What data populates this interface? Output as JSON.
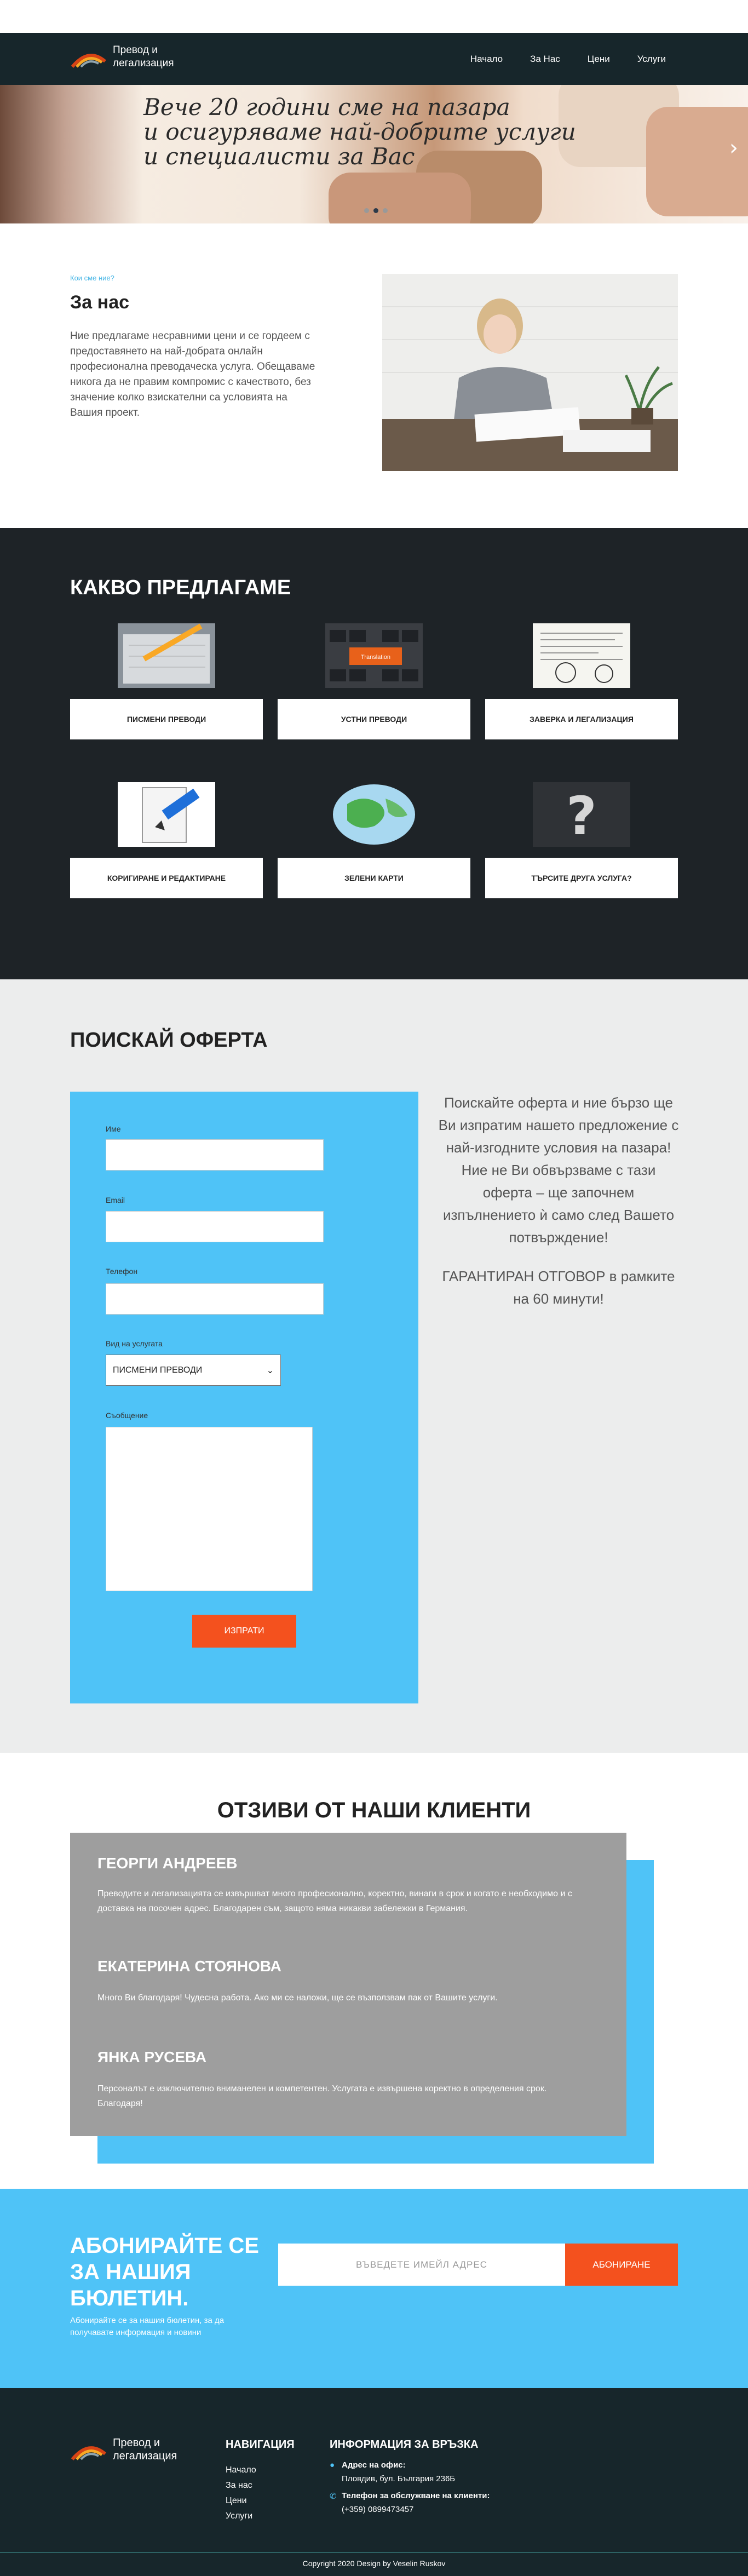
{
  "brand": {
    "name_line1": "Превод и",
    "name_line2": "легализация"
  },
  "nav": {
    "items": [
      "Начало",
      "За Нас",
      "Цени",
      "Услуги"
    ]
  },
  "hero": {
    "lines": [
      "Вече 20 години сме на пазара",
      "и осигуряваме най-добрите услуги",
      "и специалисти за Вас"
    ],
    "next_icon": "chevron-right-icon",
    "slides": 3,
    "active_slide": 1
  },
  "about": {
    "kicker": "Кои сме ние?",
    "title": "За нас",
    "text": "Ние предлагаме несравними цени и се гордеем с предоставянето на най-добрата онлайн професионална преводаческа услуга. Обещаваме никога да не правим компромис с качеството, без значение колко взискателни са условията на Вашия проект."
  },
  "services": {
    "title": "КАКВО ПРЕДЛАГАМЕ",
    "items": [
      {
        "label": "ПИСМЕНИ ПРЕВОДИ",
        "icon": "pen-on-book-icon"
      },
      {
        "label": "УСТНИ ПРЕВОДИ",
        "icon": "keyboard-translate-key-icon"
      },
      {
        "label": "ЗАВЕРКА И ЛЕГАЛИЗАЦИЯ",
        "icon": "stamped-document-icon"
      },
      {
        "label": "КОРИГИРАНЕ И РЕДАКТИРАНЕ",
        "icon": "document-pencil-icon"
      },
      {
        "label": "ЗЕЛЕНИ КАРТИ",
        "icon": "globe-icon"
      },
      {
        "label": "ТЪРСИТЕ ДРУГА УСЛУГА?",
        "icon": "question-mark-icon"
      }
    ]
  },
  "offer": {
    "title": "ПОИСКАЙ ОФЕРТА",
    "form": {
      "name_label": "Име",
      "email_label": "Email",
      "phone_label": "Телефон",
      "service_label": "Вид на услугата",
      "service_value": "ПИСМЕНИ ПРЕВОДИ",
      "message_label": "Съобщение",
      "submit": "ИЗПРАТИ"
    },
    "text1": "Поискайте оферта и ние бързо ще Ви изпратим нашето предложение с най-изгодните условия на пазара! Ние не Ви обвързваме с тази оферта – ще започнем изпълнението ѝ само след Вашето потвърждение!",
    "text2": "ГАРАНТИРАН ОТГОВОР в рамките на 60 минути!"
  },
  "testimonials": {
    "title": "ОТЗИВИ ОТ НАШИ КЛИЕНТИ",
    "items": [
      {
        "name": "ГЕОРГИ АНДРЕЕВ",
        "text": "Преводите и легализацията се извършват много професионално, коректно, винаги в срок и когато е необходимо и с доставка на посочен адрес. Благодарен съм, защото няма никакви забележки в Германия."
      },
      {
        "name": "ЕКАТЕРИНА СТОЯНОВА",
        "text": "Много Ви благодаря! Чудесна работа. Ако ми се наложи, ще се възползвам пак от Вашите услуги."
      },
      {
        "name": "ЯНКА РУСЕВА",
        "text": "Персоналът е изключително вниманелен и компетентен. Услугата е извършена коректно в определения срок. Благодаря!"
      }
    ]
  },
  "newsletter": {
    "title": "АБОНИРАЙТЕ СЕ ЗА НАШИЯ БЮЛЕТИН.",
    "subtitle": "Абонирайте се за нашия бюлетин, за да получавате информация и новини",
    "placeholder": "ВЪВЕДЕТЕ ИМЕЙЛ АДРЕС",
    "button": "АБОНИРАНЕ"
  },
  "footer": {
    "nav_title": "НАВИГАЦИЯ",
    "nav_items": [
      "Начало",
      "За нас",
      "Цени",
      "Услуги"
    ],
    "contact_title": "ИНФОРМАЦИЯ ЗА ВРЪЗКА",
    "address_label": "Адрес на офис:",
    "address_value": "Пловдив, бул. България 236Б",
    "phone_label": "Телефон за обслужване на клиенти:",
    "phone_value": "(+359) 0899473457",
    "copyright": "Copyright 2020 Design by Veselin Ruskov"
  },
  "colors": {
    "dark": "#17262b",
    "accent": "#4fc3f7",
    "cta": "#f4511e",
    "services_bg": "#1e2327",
    "offer_bg": "#eceded"
  }
}
